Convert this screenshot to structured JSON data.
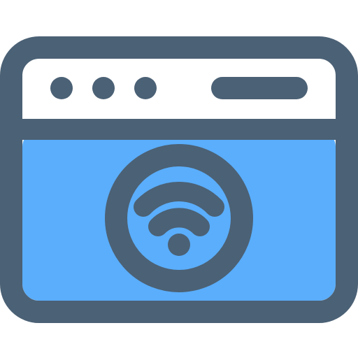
{
  "icon": {
    "name": "browser-window-wifi-icon",
    "colors": {
      "outline": "#4b6175",
      "titlebar": "#ffffff",
      "content": "#5aaefc",
      "circle_fill": "#5aaefc"
    },
    "titlebar_dots": [
      "dot-1",
      "dot-2",
      "dot-3"
    ],
    "wifi_arcs": [
      "outer-arc",
      "middle-arc"
    ]
  }
}
